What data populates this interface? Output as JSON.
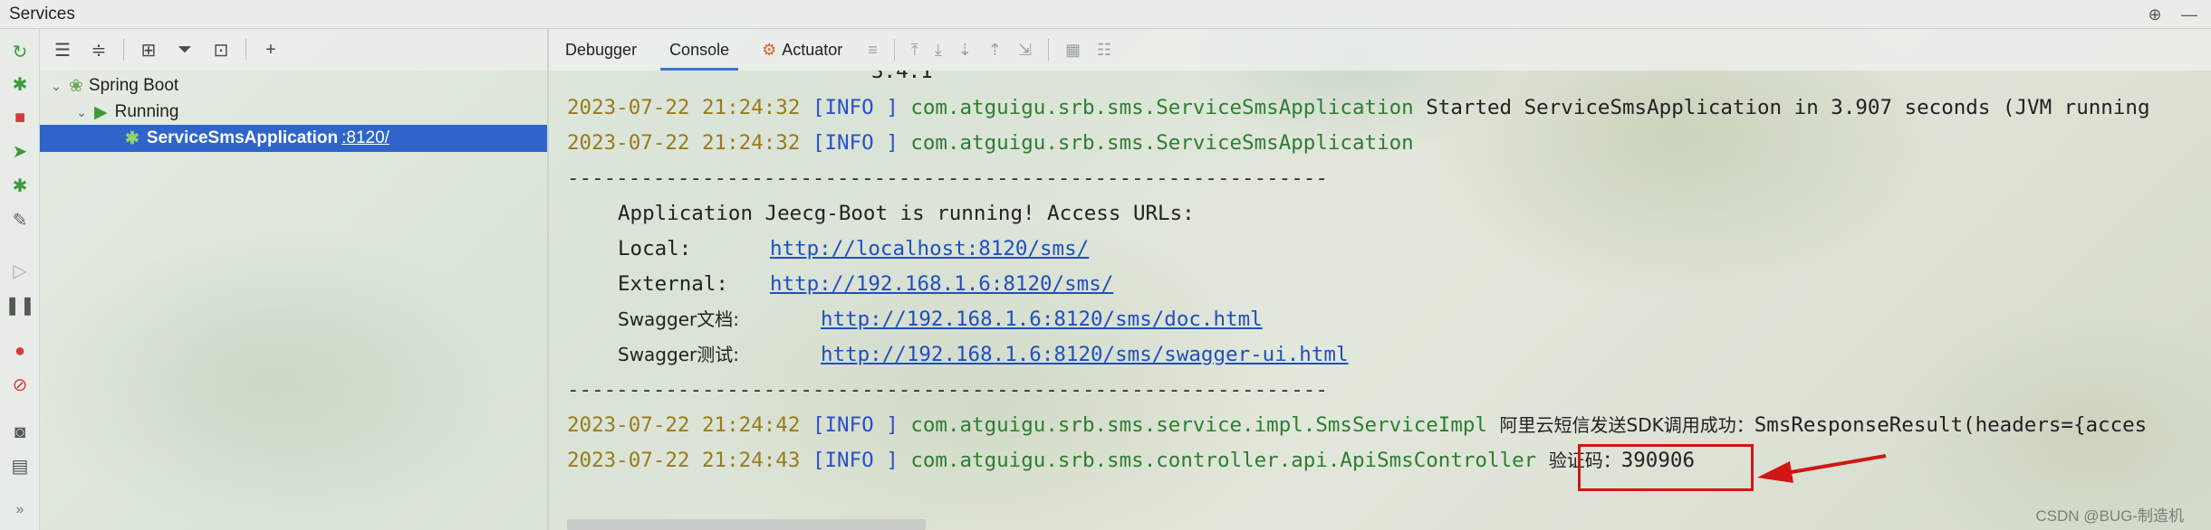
{
  "window": {
    "title": "Services"
  },
  "tree": {
    "items": [
      {
        "label": "Spring Boot"
      },
      {
        "label": "Running"
      },
      {
        "label": "ServiceSmsApplication",
        "port": ":8120/"
      }
    ]
  },
  "tabs": [
    {
      "label": "Debugger"
    },
    {
      "label": "Console"
    },
    {
      "label": "Actuator"
    }
  ],
  "console": {
    "partial_top": "3.4.1",
    "line1": {
      "ts": "2023-07-22 21:24:32",
      "level": "[INFO ]",
      "cls": "com.atguigu.srb.sms.ServiceSmsApplication",
      "msg": "Started ServiceSmsApplication in 3.907 seconds (JVM running"
    },
    "line2": {
      "ts": "2023-07-22 21:24:32",
      "level": "[INFO ]",
      "cls": "com.atguigu.srb.sms.ServiceSmsApplication"
    },
    "divider": "--------------------------------------------------------------",
    "banner": {
      "heading": "Application Jeecg-Boot is running! Access URLs:",
      "local_label": "Local:",
      "local_url": "http://localhost:8120/sms/",
      "external_label": "External:",
      "external_url": "http://192.168.1.6:8120/sms/",
      "swagger_doc_label": "Swagger文档:",
      "swagger_doc_url": "http://192.168.1.6:8120/sms/doc.html",
      "swagger_test_label": "Swagger测试:",
      "swagger_test_url": "http://192.168.1.6:8120/sms/swagger-ui.html"
    },
    "line3": {
      "ts": "2023-07-22 21:24:42",
      "level": "[INFO ]",
      "cls": "com.atguigu.srb.sms.service.impl.SmsServiceImpl",
      "msg_cjk": "阿里云短信发送SDK调用成功：",
      "msg": "SmsResponseResult(headers={acces"
    },
    "line4": {
      "ts": "2023-07-22 21:24:43",
      "level": "[INFO ]",
      "cls": "com.atguigu.srb.sms.controller.api.ApiSmsController",
      "code_label": "验证码：",
      "code": "390906"
    }
  },
  "watermark": "CSDN @BUG-制造机",
  "colors": {
    "selection": "#2f65ca",
    "timestamp": "#9a7b1c",
    "level": "#2b50c8",
    "class": "#2e7d32",
    "annotation": "#d01616"
  }
}
